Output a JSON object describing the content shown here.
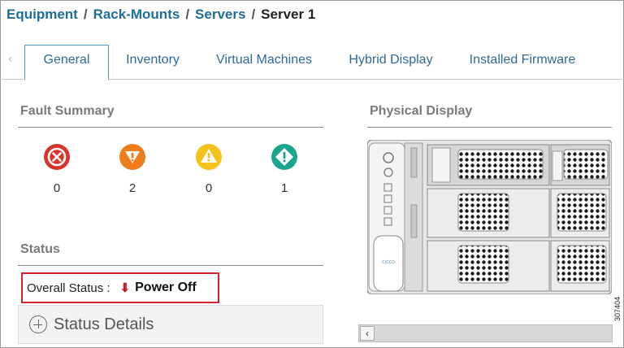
{
  "breadcrumb": {
    "items": [
      "Equipment",
      "Rack-Mounts",
      "Servers"
    ],
    "separator": "/",
    "current": "Server 1"
  },
  "tabs": [
    "General",
    "Inventory",
    "Virtual Machines",
    "Hybrid Display",
    "Installed Firmware"
  ],
  "active_tab": "General",
  "fault_summary": {
    "title": "Fault Summary",
    "items": [
      {
        "icon": "critical-icon",
        "color": "#d9342b",
        "count": "0"
      },
      {
        "icon": "major-icon",
        "color": "#ef7d1e",
        "count": "2"
      },
      {
        "icon": "minor-icon",
        "color": "#f5c21b",
        "count": "0"
      },
      {
        "icon": "warning-icon",
        "color": "#1aa58f",
        "count": "1"
      }
    ]
  },
  "status": {
    "title": "Status",
    "overall_label": "Overall Status :",
    "overall_value": "Power Off",
    "details_label": "Status Details"
  },
  "physical_display": {
    "title": "Physical Display",
    "brand": "cisco"
  },
  "figure_id": "307404"
}
